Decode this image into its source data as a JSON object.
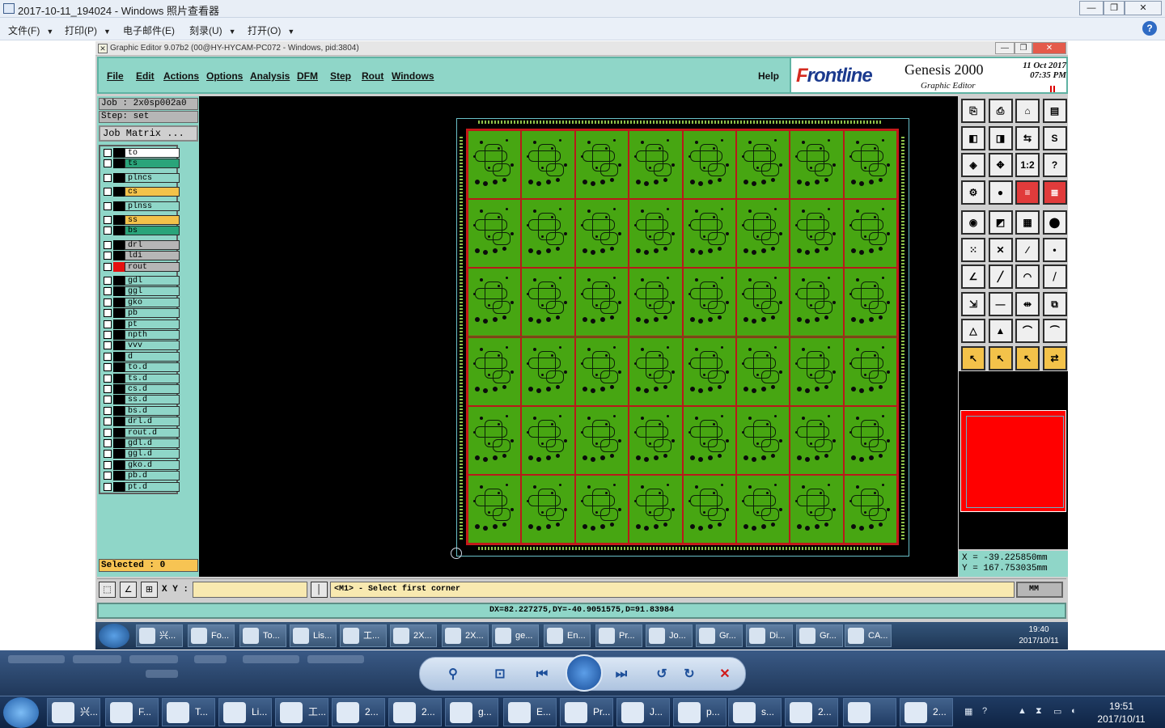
{
  "viewer": {
    "title": "2017-10-11_194024 - Windows 照片查看器",
    "menu": [
      "文件(F)",
      "打印(P)",
      "电子邮件(E)",
      "刻录(U)",
      "打开(O)"
    ],
    "help": "?",
    "minimize": "—",
    "restore": "❐",
    "close": "✕"
  },
  "ge": {
    "title": "Graphic Editor 9.07b2 (00@HY-HYCAM-PC072 - Windows, pid:3804)",
    "menu": [
      "File",
      "Edit",
      "Actions",
      "Options",
      "Analysis",
      "DFM",
      "Step",
      "Rout",
      "Windows"
    ],
    "help": "Help",
    "logo": {
      "brand": "rontline",
      "brand_initial": "F",
      "product": "Genesis 2000",
      "sub": "Graphic Editor",
      "date": "11 Oct 2017",
      "time": "07:35 PM"
    },
    "job": "Job : 2x0sp002a0",
    "step": "Step: set",
    "job_matrix": "Job Matrix ...",
    "selected": "Selected : 0",
    "xy_label": "X Y :",
    "xy_value": "",
    "prompt": "<M1> - Select first corner",
    "units": "MM",
    "status": "DX=82.227275,DY=-40.9051575,D=91.83984",
    "coords": {
      "x": "X = -39.225850mm",
      "y": "Y = 167.753035mm"
    },
    "layers": [
      {
        "name": "to",
        "color": "#ffffff",
        "sep": 0
      },
      {
        "name": "ts",
        "color": "#2aa47a",
        "sep": 0
      },
      {
        "name": "plncs",
        "color": "#8fd6c8",
        "sep": 1
      },
      {
        "name": "cs",
        "color": "#f3c24a",
        "sep": 1
      },
      {
        "name": "plnss",
        "color": "#8fd6c8",
        "sep": 1
      },
      {
        "name": "ss",
        "color": "#f3c24a",
        "sep": 1
      },
      {
        "name": "bs",
        "color": "#2aa47a",
        "sep": 0
      },
      {
        "name": "drl",
        "color": "#b6b6b6",
        "sep": 1
      },
      {
        "name": "ldi",
        "color": "#b6b6b6",
        "sep": 0
      },
      {
        "name": "rout",
        "color": "#b6b6b6",
        "sep": 0,
        "active": true
      },
      {
        "name": "gdl",
        "color": "#8fd6c8",
        "sep": 1
      },
      {
        "name": "ggl",
        "color": "#8fd6c8",
        "sep": 0
      },
      {
        "name": "gko",
        "color": "#8fd6c8",
        "sep": 0
      },
      {
        "name": "pb",
        "color": "#8fd6c8",
        "sep": 0
      },
      {
        "name": "pt",
        "color": "#8fd6c8",
        "sep": 0
      },
      {
        "name": "npth",
        "color": "#8fd6c8",
        "sep": 0
      },
      {
        "name": "vvv",
        "color": "#8fd6c8",
        "sep": 0
      },
      {
        "name": "d",
        "color": "#8fd6c8",
        "sep": 0
      },
      {
        "name": "to.d",
        "color": "#8fd6c8",
        "sep": 0
      },
      {
        "name": "ts.d",
        "color": "#8fd6c8",
        "sep": 0
      },
      {
        "name": "cs.d",
        "color": "#8fd6c8",
        "sep": 0
      },
      {
        "name": "ss.d",
        "color": "#8fd6c8",
        "sep": 0
      },
      {
        "name": "bs.d",
        "color": "#8fd6c8",
        "sep": 0
      },
      {
        "name": "drl.d",
        "color": "#8fd6c8",
        "sep": 0
      },
      {
        "name": "rout.d",
        "color": "#8fd6c8",
        "sep": 0
      },
      {
        "name": "gdl.d",
        "color": "#8fd6c8",
        "sep": 0
      },
      {
        "name": "ggl.d",
        "color": "#8fd6c8",
        "sep": 0
      },
      {
        "name": "gko.d",
        "color": "#8fd6c8",
        "sep": 0
      },
      {
        "name": "pb.d",
        "color": "#8fd6c8",
        "sep": 0
      },
      {
        "name": "pt.d",
        "color": "#8fd6c8",
        "sep": 0
      }
    ],
    "tools": [
      {
        "n": "copy-to-clipboard",
        "s": "⎘",
        "c": "w"
      },
      {
        "n": "save-view",
        "s": "⎙",
        "c": "w"
      },
      {
        "n": "home-view",
        "s": "⌂",
        "c": "w"
      },
      {
        "n": "snapshot",
        "s": "▤",
        "c": "w"
      },
      {
        "n": "zoom-left",
        "s": "◧",
        "c": "w"
      },
      {
        "n": "zoom-right",
        "s": "◨",
        "c": "w"
      },
      {
        "n": "pan-step",
        "s": "⇆",
        "c": "w"
      },
      {
        "n": "redraw",
        "s": "S",
        "c": "w"
      },
      {
        "n": "zoom-fit",
        "s": "◈",
        "c": "w"
      },
      {
        "n": "zoom-center",
        "s": "✥",
        "c": "w"
      },
      {
        "n": "zoom-1-2",
        "s": "1:2",
        "c": "w"
      },
      {
        "n": "query-help",
        "s": "?",
        "c": "w"
      },
      {
        "n": "measure-gear",
        "s": "⚙",
        "c": "w"
      },
      {
        "n": "snap-toggle",
        "s": "●",
        "c": "w"
      },
      {
        "n": "filter-red",
        "s": "≡",
        "c": "r"
      },
      {
        "n": "filter-red-2",
        "s": "≣",
        "c": "r"
      },
      {
        "n": "select-feature",
        "s": "◉",
        "c": "w"
      },
      {
        "n": "select-area",
        "s": "◩",
        "c": "w"
      },
      {
        "n": "ruler",
        "s": "▦",
        "c": "w"
      },
      {
        "n": "pad-select",
        "s": "⬤",
        "c": "w"
      },
      {
        "n": "add-line-net",
        "s": "⁙",
        "c": "w"
      },
      {
        "n": "delete-x",
        "s": "✕",
        "c": "w"
      },
      {
        "n": "add-segment",
        "s": "∕",
        "c": "w"
      },
      {
        "n": "add-pad",
        "s": "•",
        "c": "w"
      },
      {
        "n": "draw-angle",
        "s": "∠",
        "c": "w"
      },
      {
        "n": "draw-line",
        "s": "╱",
        "c": "w"
      },
      {
        "n": "draw-arc",
        "s": "◠",
        "c": "w"
      },
      {
        "n": "mirror",
        "s": "⧸",
        "c": "w"
      },
      {
        "n": "move-copy",
        "s": "⇲",
        "c": "w"
      },
      {
        "n": "horizontal-line",
        "s": "—",
        "c": "w"
      },
      {
        "n": "dimension",
        "s": "⇹",
        "c": "w"
      },
      {
        "n": "shape-group",
        "s": "⧉",
        "c": "w"
      },
      {
        "n": "triangle-1",
        "s": "△",
        "c": "w"
      },
      {
        "n": "triangle-2",
        "s": "▲",
        "c": "w"
      },
      {
        "n": "arch-1",
        "s": "⌒",
        "c": "w"
      },
      {
        "n": "arch-2",
        "s": "⏜",
        "c": "w"
      },
      {
        "n": "pointer-1",
        "s": "↖",
        "c": "y"
      },
      {
        "n": "pointer-2",
        "s": "↖",
        "c": "y"
      },
      {
        "n": "pointer-3",
        "s": "↖",
        "c": "y"
      },
      {
        "n": "pointer-4",
        "s": "⇄",
        "c": "y"
      }
    ]
  },
  "inner_taskbar": {
    "items": [
      "兴...",
      "Fo...",
      "To...",
      "Lis...",
      "工...",
      "2X...",
      "2X...",
      "ge...",
      "En...",
      "Pr...",
      "Jo...",
      "Gr...",
      "Di...",
      "Gr...",
      "CA..."
    ],
    "time": "19:40",
    "date": "2017/10/11"
  },
  "taskbar": {
    "items": [
      "兴...",
      "F...",
      "T...",
      "Li...",
      "工...",
      "2...",
      "2...",
      "g...",
      "E...",
      "Pr...",
      "J...",
      "p...",
      "s...",
      "2...",
      "",
      "2..."
    ],
    "time": "19:51",
    "date": "2017/10/11"
  }
}
